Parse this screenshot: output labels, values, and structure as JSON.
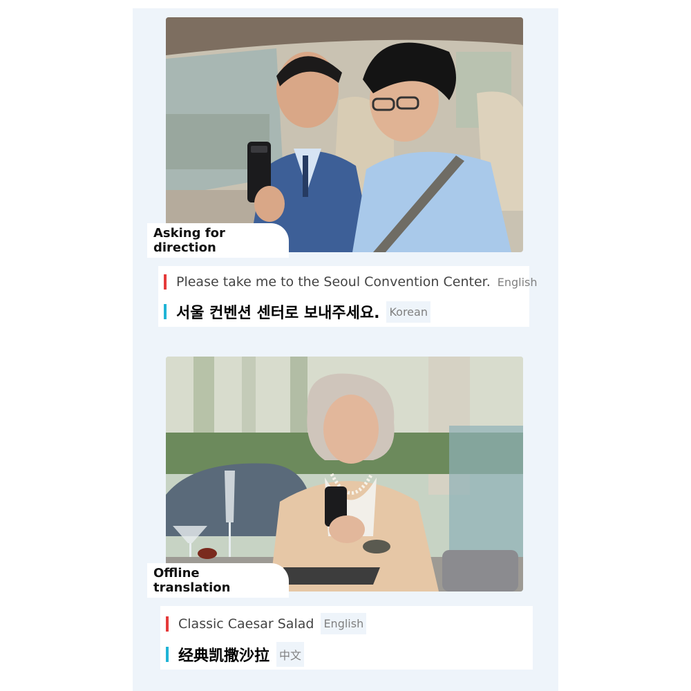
{
  "section1": {
    "caption": "Asking for direction",
    "source_text": "Please take me to the Seoul Convention Center.",
    "source_lang": "English",
    "target_text": "서울 컨벤션 센터로 보내주세요.",
    "target_lang": "Korean"
  },
  "section2": {
    "caption": "Offline translation",
    "source_text": "Classic Caesar Salad",
    "source_lang": "English",
    "target_text": "经典凯撒沙拉",
    "target_lang": "中文"
  },
  "colors": {
    "panel_bg": "#eef4fa",
    "source_bar": "#e53a3a",
    "target_bar": "#20b4d6"
  }
}
